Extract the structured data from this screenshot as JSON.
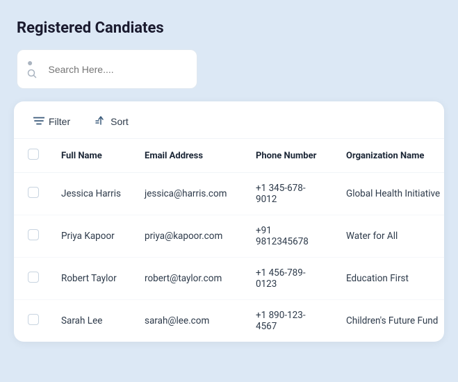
{
  "page": {
    "title": "Registered Candiates",
    "background": "#dce8f5"
  },
  "search": {
    "placeholder": "Search Here...."
  },
  "toolbar": {
    "filter_label": "Filter",
    "sort_label": "Sort"
  },
  "table": {
    "columns": [
      {
        "id": "name",
        "label": "Full Name"
      },
      {
        "id": "email",
        "label": "Email Address"
      },
      {
        "id": "phone",
        "label": "Phone Number"
      },
      {
        "id": "org",
        "label": "Organization Name"
      }
    ],
    "rows": [
      {
        "name": "Jessica Harris",
        "email": "jessica@harris.com",
        "phone": "+1 345-678-9012",
        "org": "Global Health Initiative"
      },
      {
        "name": "Priya Kapoor",
        "email": "priya@kapoor.com",
        "phone": "+91 9812345678",
        "org": "Water for All"
      },
      {
        "name": "Robert Taylor",
        "email": "robert@taylor.com",
        "phone": "+1 456-789-0123",
        "org": "Education First"
      },
      {
        "name": "Sarah Lee",
        "email": "sarah@lee.com",
        "phone": "+1 890-123-4567",
        "org": "Children's Future Fund"
      }
    ]
  }
}
